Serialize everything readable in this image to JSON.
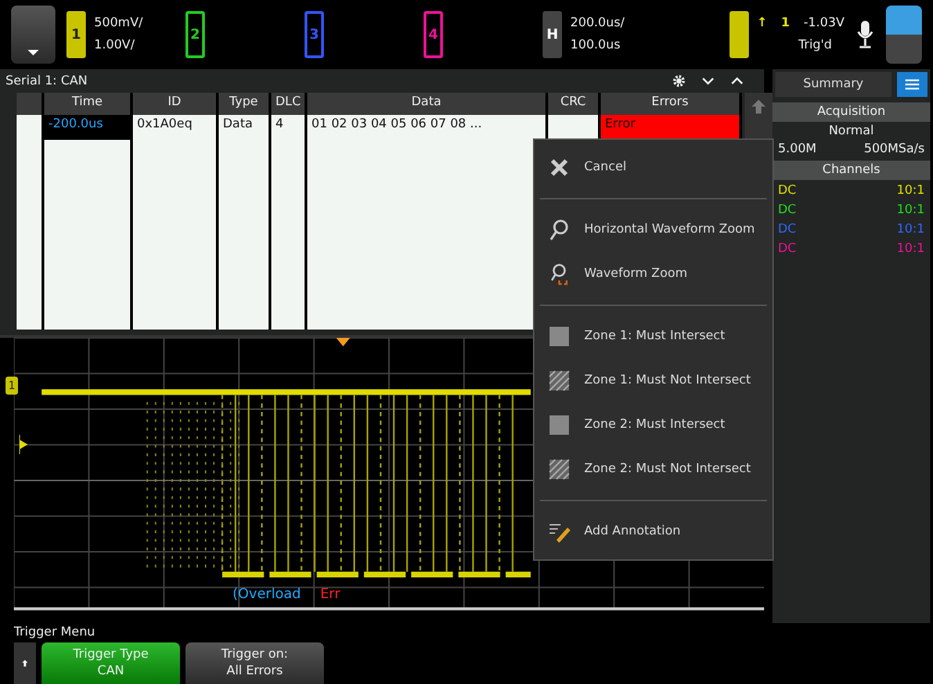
{
  "top_bar": {
    "channels": [
      {
        "label": "1",
        "scale": "500mV/",
        "offset": "1.00V/",
        "color": "#c8c400",
        "on": true
      },
      {
        "label": "2",
        "color": "#22cc22",
        "on": false
      },
      {
        "label": "3",
        "color": "#3355ff",
        "on": false
      },
      {
        "label": "4",
        "color": "#ee1199",
        "on": false
      }
    ],
    "horizontal": {
      "label": "H",
      "scale": "200.0us/",
      "delay": "100.0us"
    },
    "trigger": {
      "slope": "↑",
      "source": "1",
      "level": "-1.03V",
      "mode": "Trig'd"
    }
  },
  "decode": {
    "title": "Serial 1: CAN",
    "columns": [
      "Time",
      "ID",
      "Type",
      "DLC",
      "Data",
      "CRC",
      "Errors"
    ],
    "rows": [
      {
        "cells": [
          "-200.0us",
          "0x1A0eq",
          "Data",
          "4",
          "01 02 03 04 05 06 07 08 ...",
          "",
          "Error"
        ],
        "selected": true
      }
    ]
  },
  "summary": {
    "tab": "Summary",
    "acquisition_heading": "Acquisition",
    "mode": "Normal",
    "rate_left": "5.00M",
    "rate": "500MSa/s",
    "channels_heading": "Channels",
    "channels": [
      {
        "coupling": "DC",
        "probe": "10:1",
        "color": "#e0e000"
      },
      {
        "coupling": "DC",
        "probe": "10:1",
        "color": "#22dd22"
      },
      {
        "coupling": "DC",
        "probe": "10:1",
        "color": "#3366ff"
      },
      {
        "coupling": "DC",
        "probe": "10:1",
        "color": "#ee1199"
      }
    ]
  },
  "context_menu": [
    {
      "kind": "cancel",
      "label": "Cancel"
    },
    {
      "kind": "hzoom",
      "label": "Horizontal Waveform Zoom"
    },
    {
      "kind": "zoom",
      "label": "Waveform Zoom"
    },
    {
      "kind": "zone-must",
      "label": "Zone 1: Must Intersect"
    },
    {
      "kind": "zone-not",
      "label": "Zone 1: Must Not Intersect"
    },
    {
      "kind": "zone-must",
      "label": "Zone 2: Must Intersect"
    },
    {
      "kind": "zone-not",
      "label": "Zone 2: Must Not Intersect"
    },
    {
      "kind": "annotate",
      "label": "Add Annotation"
    }
  ],
  "waveform": {
    "channel_marker": "1",
    "bus_frames": [
      {
        "text": "(Overload",
        "color": "#22aaff"
      },
      {
        "text": "Err",
        "color": "#ff2020"
      }
    ]
  },
  "softkeys": {
    "menu_title": "Trigger Menu",
    "keys": [
      {
        "title": "Trigger Type",
        "value": "CAN",
        "selected": true
      },
      {
        "title": "Trigger on:",
        "value": "All Errors",
        "selected": false
      }
    ]
  }
}
